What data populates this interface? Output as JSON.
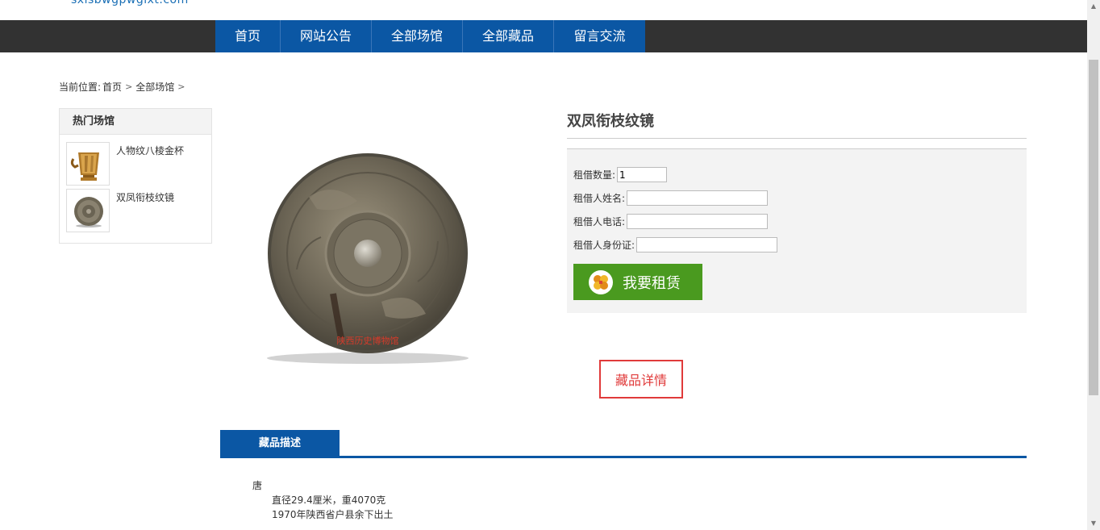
{
  "site": {
    "url_text": "sxlsbwgpwgixt.com"
  },
  "nav": {
    "items": [
      {
        "label": "首页"
      },
      {
        "label": "网站公告"
      },
      {
        "label": "全部场馆"
      },
      {
        "label": "全部藏品"
      },
      {
        "label": "留言交流"
      }
    ]
  },
  "breadcrumb": {
    "prefix": "当前位置:",
    "home": "首页",
    "section": "全部场馆",
    "sep": ">"
  },
  "sidebar": {
    "title": "热门场馆",
    "items": [
      {
        "label": "人物纹八棱金杯"
      },
      {
        "label": "双凤衔枝纹镜"
      }
    ]
  },
  "product": {
    "title": "双凤衔枝纹镜",
    "image_stamp": "陕西历史博物馆"
  },
  "form": {
    "qty_label": "租借数量:",
    "qty_value": "1",
    "name_label": "租借人姓名:",
    "phone_label": "租借人电话:",
    "id_label": "租借人身份证:",
    "submit_label": "我要租赁"
  },
  "detail_link": "藏品详情",
  "tabs": {
    "description": "藏品描述"
  },
  "description": {
    "dynasty": "唐",
    "size": "直径29.4厘米，重4070克",
    "origin": "1970年陕西省户县余下出土"
  },
  "colors": {
    "nav_bg": "#0b57a4",
    "bar_bg": "#323232",
    "button_green": "#4a9a1f",
    "accent_red": "#e03a3a"
  }
}
